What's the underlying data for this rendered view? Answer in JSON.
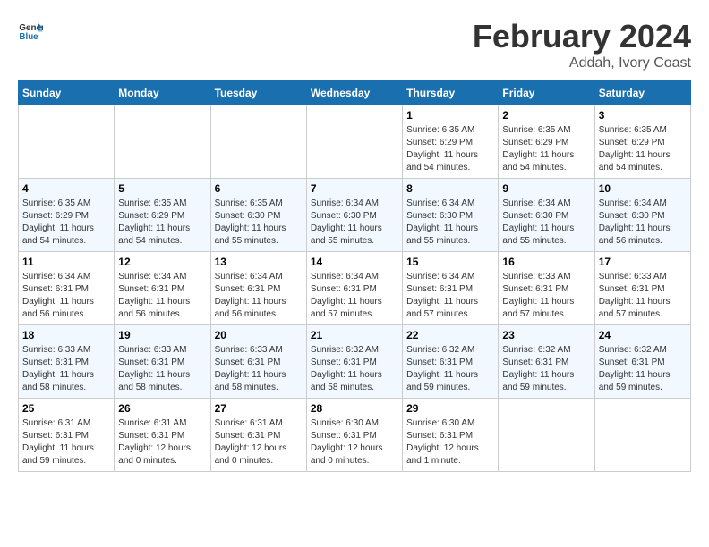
{
  "header": {
    "logo_general": "General",
    "logo_blue": "Blue",
    "month_title": "February 2024",
    "location": "Addah, Ivory Coast"
  },
  "calendar": {
    "days_of_week": [
      "Sunday",
      "Monday",
      "Tuesday",
      "Wednesday",
      "Thursday",
      "Friday",
      "Saturday"
    ],
    "weeks": [
      [
        {
          "day": "",
          "info": ""
        },
        {
          "day": "",
          "info": ""
        },
        {
          "day": "",
          "info": ""
        },
        {
          "day": "",
          "info": ""
        },
        {
          "day": "1",
          "info": "Sunrise: 6:35 AM\nSunset: 6:29 PM\nDaylight: 11 hours\nand 54 minutes."
        },
        {
          "day": "2",
          "info": "Sunrise: 6:35 AM\nSunset: 6:29 PM\nDaylight: 11 hours\nand 54 minutes."
        },
        {
          "day": "3",
          "info": "Sunrise: 6:35 AM\nSunset: 6:29 PM\nDaylight: 11 hours\nand 54 minutes."
        }
      ],
      [
        {
          "day": "4",
          "info": "Sunrise: 6:35 AM\nSunset: 6:29 PM\nDaylight: 11 hours\nand 54 minutes."
        },
        {
          "day": "5",
          "info": "Sunrise: 6:35 AM\nSunset: 6:29 PM\nDaylight: 11 hours\nand 54 minutes."
        },
        {
          "day": "6",
          "info": "Sunrise: 6:35 AM\nSunset: 6:30 PM\nDaylight: 11 hours\nand 55 minutes."
        },
        {
          "day": "7",
          "info": "Sunrise: 6:34 AM\nSunset: 6:30 PM\nDaylight: 11 hours\nand 55 minutes."
        },
        {
          "day": "8",
          "info": "Sunrise: 6:34 AM\nSunset: 6:30 PM\nDaylight: 11 hours\nand 55 minutes."
        },
        {
          "day": "9",
          "info": "Sunrise: 6:34 AM\nSunset: 6:30 PM\nDaylight: 11 hours\nand 55 minutes."
        },
        {
          "day": "10",
          "info": "Sunrise: 6:34 AM\nSunset: 6:30 PM\nDaylight: 11 hours\nand 56 minutes."
        }
      ],
      [
        {
          "day": "11",
          "info": "Sunrise: 6:34 AM\nSunset: 6:31 PM\nDaylight: 11 hours\nand 56 minutes."
        },
        {
          "day": "12",
          "info": "Sunrise: 6:34 AM\nSunset: 6:31 PM\nDaylight: 11 hours\nand 56 minutes."
        },
        {
          "day": "13",
          "info": "Sunrise: 6:34 AM\nSunset: 6:31 PM\nDaylight: 11 hours\nand 56 minutes."
        },
        {
          "day": "14",
          "info": "Sunrise: 6:34 AM\nSunset: 6:31 PM\nDaylight: 11 hours\nand 57 minutes."
        },
        {
          "day": "15",
          "info": "Sunrise: 6:34 AM\nSunset: 6:31 PM\nDaylight: 11 hours\nand 57 minutes."
        },
        {
          "day": "16",
          "info": "Sunrise: 6:33 AM\nSunset: 6:31 PM\nDaylight: 11 hours\nand 57 minutes."
        },
        {
          "day": "17",
          "info": "Sunrise: 6:33 AM\nSunset: 6:31 PM\nDaylight: 11 hours\nand 57 minutes."
        }
      ],
      [
        {
          "day": "18",
          "info": "Sunrise: 6:33 AM\nSunset: 6:31 PM\nDaylight: 11 hours\nand 58 minutes."
        },
        {
          "day": "19",
          "info": "Sunrise: 6:33 AM\nSunset: 6:31 PM\nDaylight: 11 hours\nand 58 minutes."
        },
        {
          "day": "20",
          "info": "Sunrise: 6:33 AM\nSunset: 6:31 PM\nDaylight: 11 hours\nand 58 minutes."
        },
        {
          "day": "21",
          "info": "Sunrise: 6:32 AM\nSunset: 6:31 PM\nDaylight: 11 hours\nand 58 minutes."
        },
        {
          "day": "22",
          "info": "Sunrise: 6:32 AM\nSunset: 6:31 PM\nDaylight: 11 hours\nand 59 minutes."
        },
        {
          "day": "23",
          "info": "Sunrise: 6:32 AM\nSunset: 6:31 PM\nDaylight: 11 hours\nand 59 minutes."
        },
        {
          "day": "24",
          "info": "Sunrise: 6:32 AM\nSunset: 6:31 PM\nDaylight: 11 hours\nand 59 minutes."
        }
      ],
      [
        {
          "day": "25",
          "info": "Sunrise: 6:31 AM\nSunset: 6:31 PM\nDaylight: 11 hours\nand 59 minutes."
        },
        {
          "day": "26",
          "info": "Sunrise: 6:31 AM\nSunset: 6:31 PM\nDaylight: 12 hours\nand 0 minutes."
        },
        {
          "day": "27",
          "info": "Sunrise: 6:31 AM\nSunset: 6:31 PM\nDaylight: 12 hours\nand 0 minutes."
        },
        {
          "day": "28",
          "info": "Sunrise: 6:30 AM\nSunset: 6:31 PM\nDaylight: 12 hours\nand 0 minutes."
        },
        {
          "day": "29",
          "info": "Sunrise: 6:30 AM\nSunset: 6:31 PM\nDaylight: 12 hours\nand 1 minute."
        },
        {
          "day": "",
          "info": ""
        },
        {
          "day": "",
          "info": ""
        }
      ]
    ]
  }
}
